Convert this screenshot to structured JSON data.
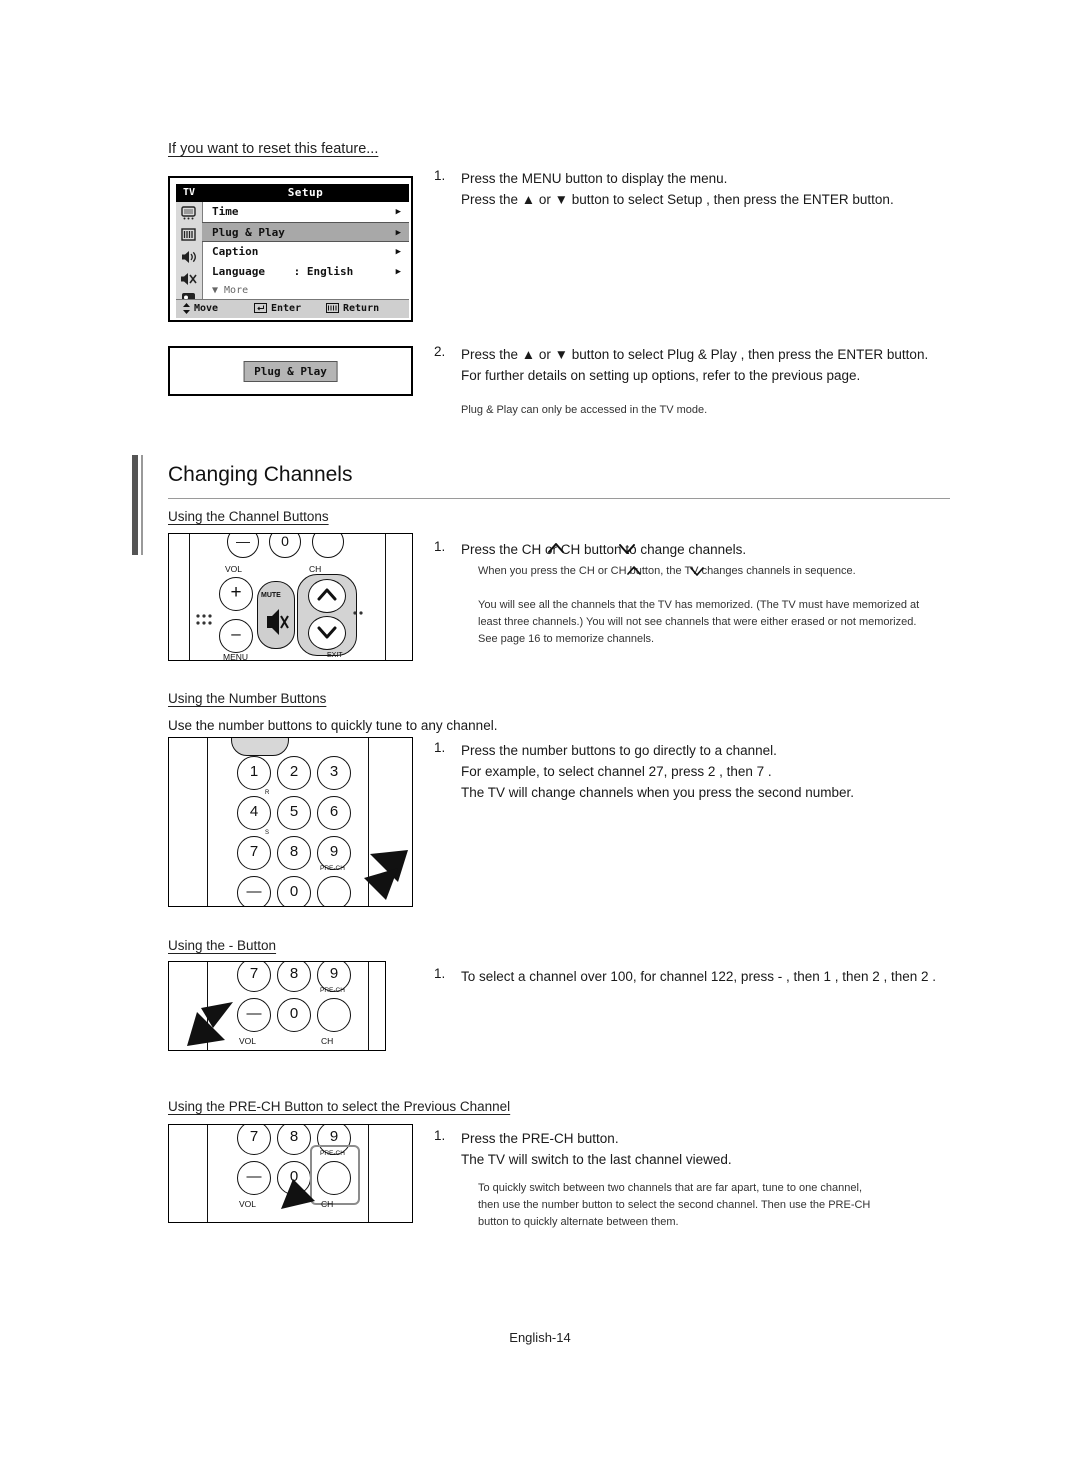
{
  "document": {
    "footer": "English-14"
  },
  "section_reset": {
    "heading": "If you want to reset this feature...",
    "osd": {
      "tv_label": "TV",
      "title": "Setup",
      "rows": [
        {
          "label": "Time",
          "value": "",
          "arrow": "▶",
          "selected": false
        },
        {
          "label": "Plug & Play",
          "value": "",
          "arrow": "▶",
          "selected": true
        },
        {
          "label": "Caption",
          "value": "",
          "arrow": "▶",
          "selected": false
        },
        {
          "label": "Language",
          "value": ": English",
          "arrow": "▶",
          "selected": false
        }
      ],
      "more": "▼ More",
      "footer": {
        "move": "Move",
        "enter": "Enter",
        "return": "Return",
        "move_icon": "up-down-arrows-icon",
        "enter_icon": "enter-key-icon",
        "return_icon": "return-key-icon"
      }
    },
    "plug_play_chip": "Plug & Play",
    "steps": [
      {
        "number": "1.",
        "text": "Press the MENU button to display the menu.\nPress the ▲ or ▼ button to select  Setup , then press the  ENTER button."
      },
      {
        "number": "2.",
        "text": "Press the ▲ or ▼ button to select  Plug & Play , then press the  ENTER button.\nFor further details on setting up options, refer to the previous page."
      }
    ],
    "note": "Plug & Play can only be accessed in the TV mode."
  },
  "changing_channels": {
    "title": "Changing Channels",
    "subsections": [
      {
        "heading": "Using the Channel Buttons",
        "step_number": "1.",
        "step_text": "Press the CH        or CH        button to change channels.",
        "notes": [
          "When you press the CH        or CH       button, the TV changes channels in sequence.",
          "You will see all the channels that the TV has memorized. (The TV must have memorized at least three channels.) You will not see channels that were either erased or not  memorized. See page 16 to memorize channels."
        ],
        "remote_labels": {
          "vol": "VOL",
          "ch": "CH",
          "mute": "MUTE",
          "menu": "MENU",
          "exit": "EXIT",
          "zero": "0",
          "minus": "—"
        }
      },
      {
        "heading": "Using the Number Buttons",
        "intro": "Use the number buttons to quickly tune to any channel.",
        "step_number": "1.",
        "step_text": "Press the number buttons to go directly to a channel.\nFor example, to select channel 27, press  2 , then  7 .\nThe TV will change channels when you press the second number.",
        "keys": [
          "1",
          "2",
          "3",
          "4",
          "5",
          "6",
          "7",
          "8",
          "9",
          "0"
        ],
        "minus_key": "—",
        "prech_label": "PRE-CH"
      },
      {
        "heading": "Using the  -  Button",
        "step_number": "1.",
        "step_text": "To select a channel over 100, for channel 122, press  - , then  1 , then  2 , then  2 .",
        "keys": [
          "7",
          "8",
          "9",
          "0"
        ],
        "minus_key": "—",
        "prech_label": "PRE-CH",
        "vol_label": "VOL",
        "ch_label": "CH"
      },
      {
        "heading": "Using the PRE-CH Button to select the Previous Channel",
        "step_number": "1.",
        "step_text": "Press the PRE-CH button.\nThe TV will switch to the last channel viewed.",
        "note": "To quickly switch between two channels that are far apart, tune to one channel,\nthen use the number button to select the second channel. Then use the PRE-CH\nbutton to quickly alternate between them.",
        "keys": [
          "7",
          "8",
          "9",
          "0"
        ],
        "minus_key": "—",
        "prech_label": "PRE-CH",
        "vol_label": "VOL",
        "ch_label": "CH"
      }
    ]
  },
  "colors": {
    "text": "#1a1a1a",
    "rule": "#9a9a9a",
    "accent_bar": "#555555",
    "osd_header": "#000000",
    "osd_select": "#a8a8a8"
  }
}
